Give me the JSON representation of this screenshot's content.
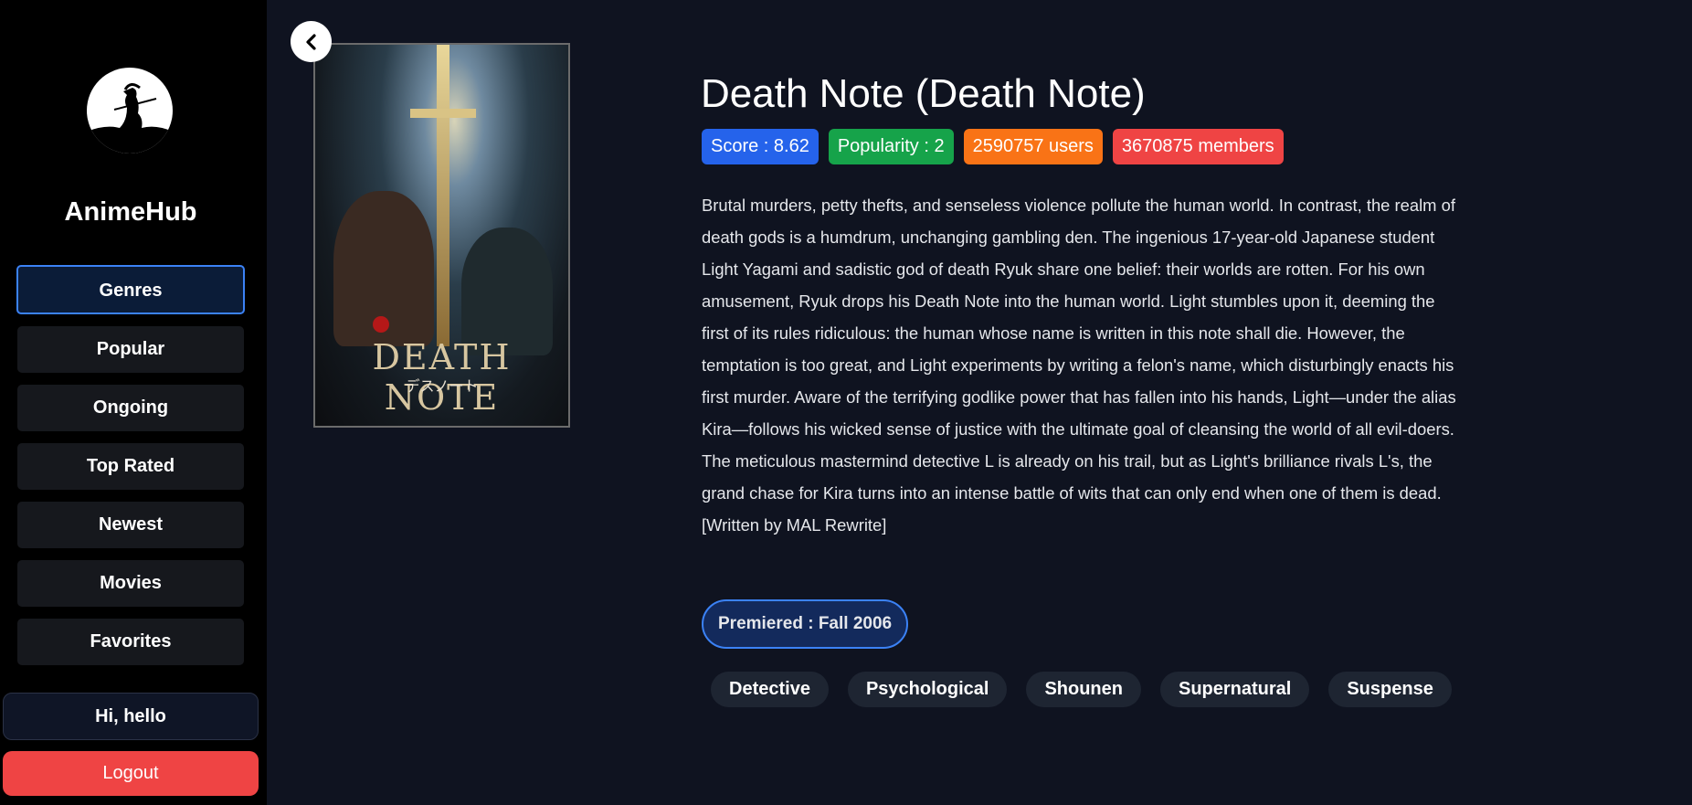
{
  "app": {
    "name": "AnimeHub"
  },
  "sidebar": {
    "items": [
      {
        "label": "Genres",
        "active": true
      },
      {
        "label": "Popular"
      },
      {
        "label": "Ongoing"
      },
      {
        "label": "Top Rated"
      },
      {
        "label": "Newest"
      },
      {
        "label": "Movies"
      },
      {
        "label": "Favorites"
      }
    ],
    "greeting": "Hi, hello",
    "logout_label": "Logout"
  },
  "anime": {
    "title": "Death Note (Death Note)",
    "poster": {
      "title_text": "DEATH NOTE",
      "subtitle_text": "デスノート"
    },
    "badges": [
      {
        "label": "Score : 8.62",
        "color": "#2563eb"
      },
      {
        "label": "Popularity : 2",
        "color": "#16a34a"
      },
      {
        "label": "2590757 users",
        "color": "#f97316"
      },
      {
        "label": "3670875 members",
        "color": "#ef4444"
      }
    ],
    "synopsis": "Brutal murders, petty thefts, and senseless violence pollute the human world. In contrast, the realm of death gods is a humdrum, unchanging gambling den. The ingenious 17-year-old Japanese student Light Yagami and sadistic god of death Ryuk share one belief: their worlds are rotten. For his own amusement, Ryuk drops his Death Note into the human world. Light stumbles upon it, deeming the first of its rules ridiculous: the human whose name is written in this note shall die. However, the temptation is too great, and Light experiments by writing a felon's name, which disturbingly enacts his first murder. Aware of the terrifying godlike power that has fallen into his hands, Light—under the alias Kira—follows his wicked sense of justice with the ultimate goal of cleansing the world of all evil-doers. The meticulous mastermind detective L is already on his trail, but as Light's brilliance rivals L's, the grand chase for Kira turns into an intense battle of wits that can only end when one of them is dead. [Written by MAL Rewrite]",
    "premiered": "Premiered : Fall 2006",
    "genres": [
      "Detective",
      "Psychological",
      "Shounen",
      "Supernatural",
      "Suspense"
    ]
  },
  "icons": {
    "back": "chevron-left-icon",
    "logo": "samurai-moon-logo"
  }
}
